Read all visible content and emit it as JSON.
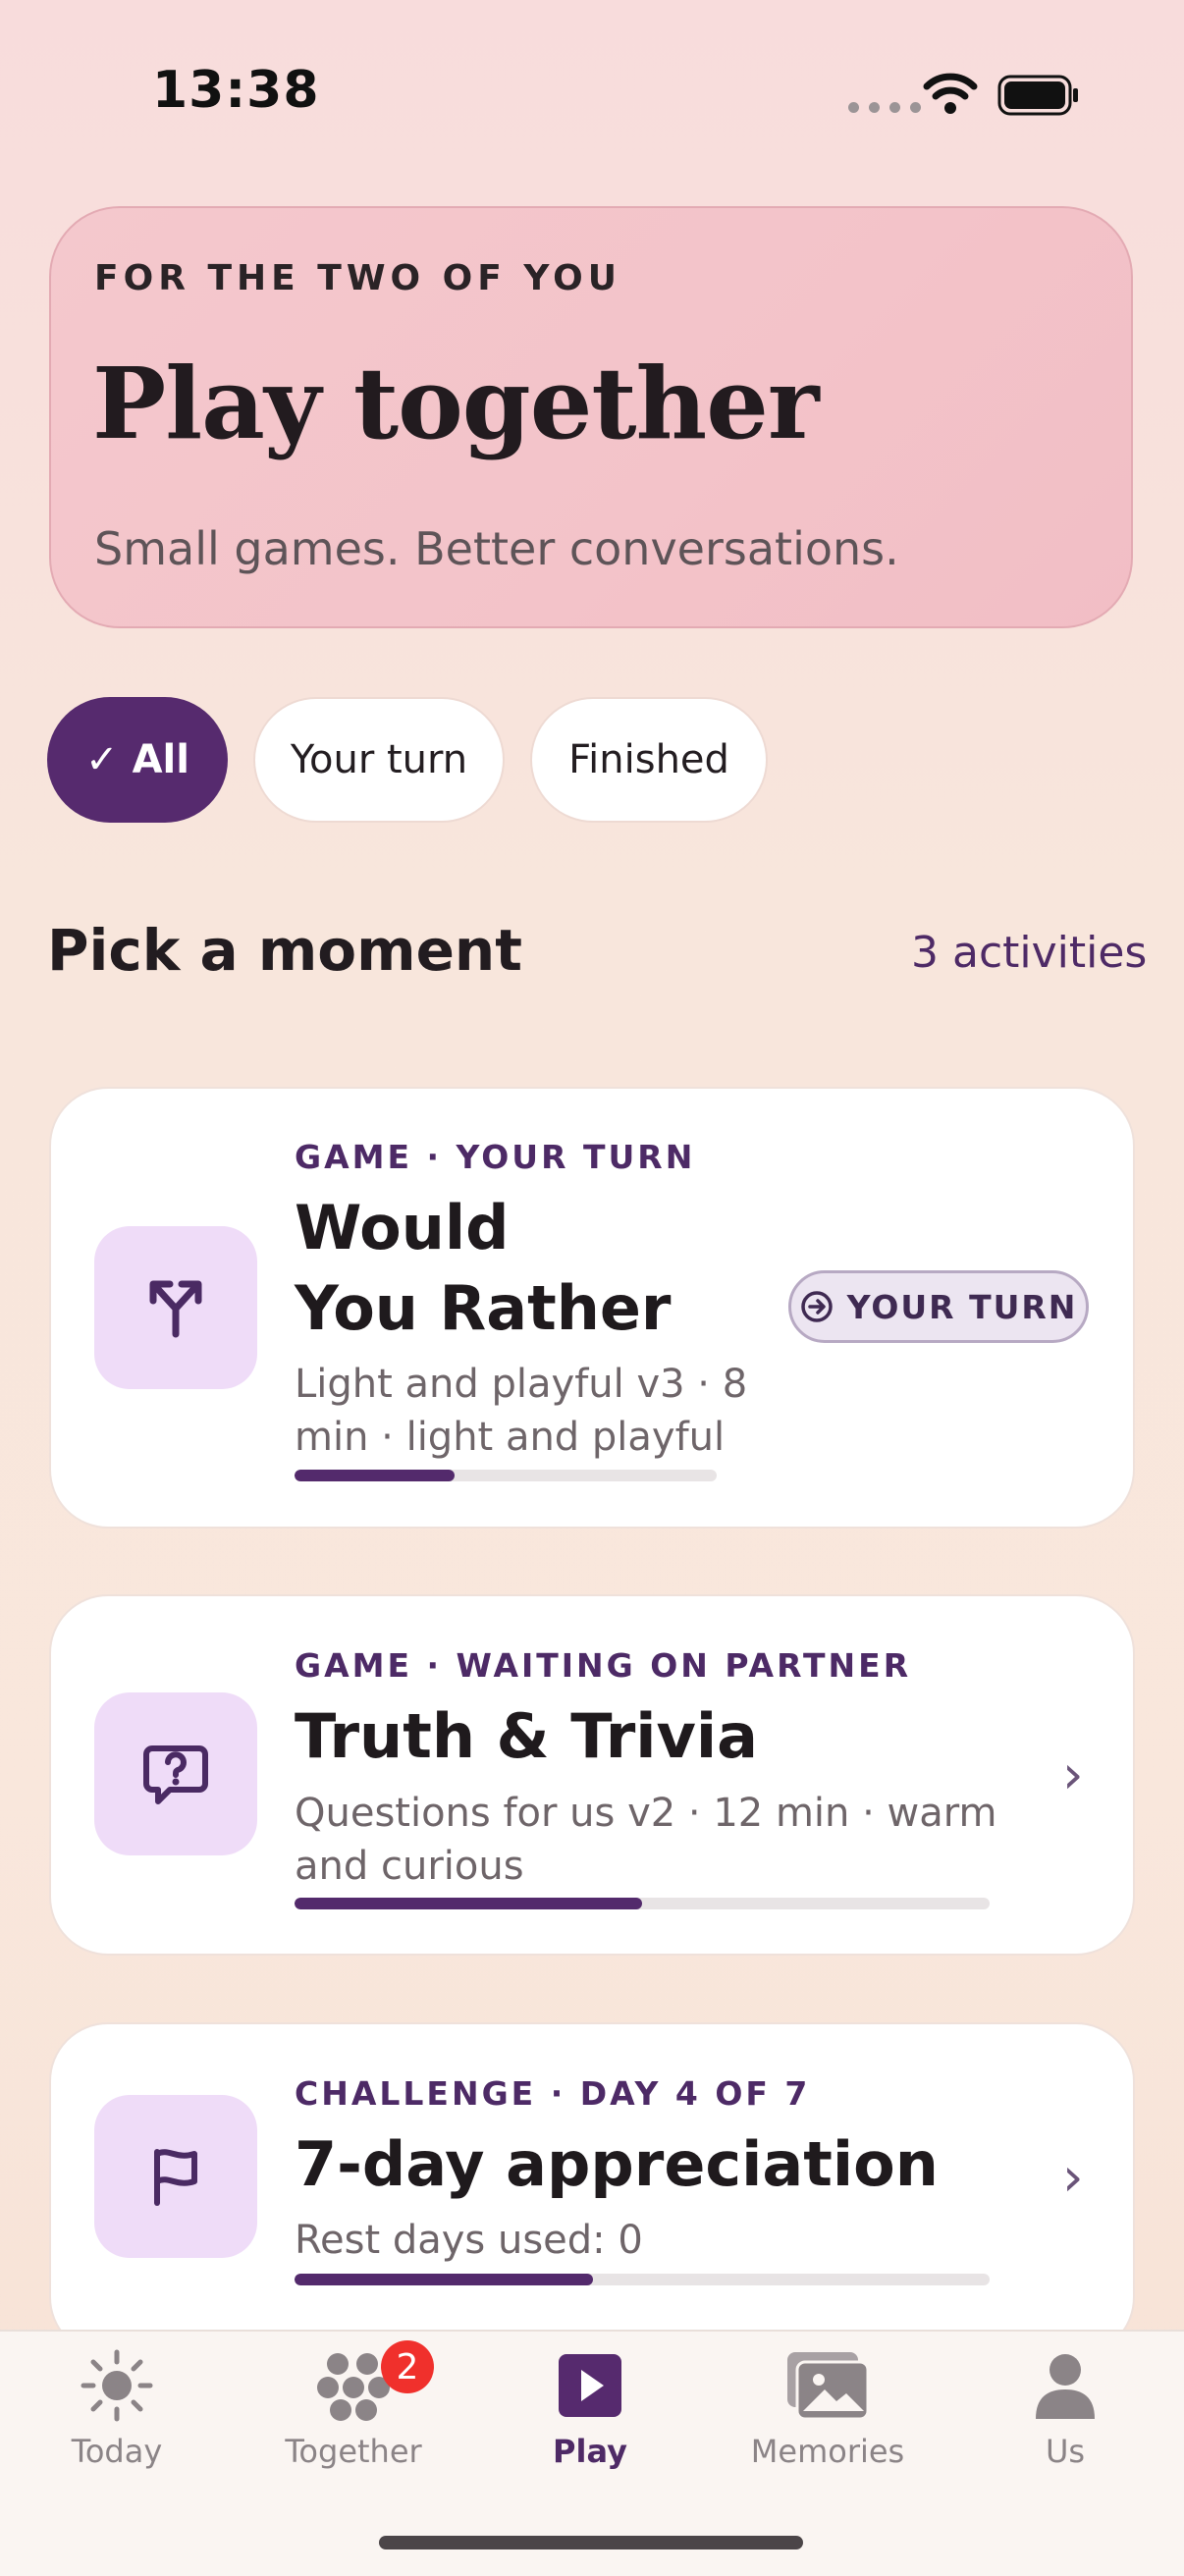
{
  "status_bar": {
    "time": "13:38"
  },
  "hero": {
    "kicker": "FOR THE TWO OF YOU",
    "title": "Play together",
    "subtitle": "Small games. Better conversations."
  },
  "filters": {
    "all": "All",
    "your_turn": "Your turn",
    "finished": "Finished",
    "selected": "All"
  },
  "section": {
    "title": "Pick a moment",
    "count": "3 activities"
  },
  "cards": [
    {
      "eyebrow": "GAME · YOUR TURN",
      "title_line1": "Would",
      "title_line2": "You Rather",
      "sub_line1": "Light and playful v3 · 8",
      "sub_line2": "min · light and playful",
      "badge": "YOUR TURN",
      "progress": 0.38,
      "icon": "split-arrow-icon"
    },
    {
      "eyebrow": "GAME · WAITING ON PARTNER",
      "title": "Truth & Trivia",
      "sub_line1": "Questions for us v2 · 12 min · warm",
      "sub_line2": "and curious",
      "progress": 0.5,
      "icon": "question-bubble-icon"
    },
    {
      "eyebrow": "CHALLENGE · DAY 4 OF 7",
      "title": "7-day appreciation",
      "sub_line1": "Rest days used: 0",
      "progress": 0.43,
      "icon": "flag-icon"
    }
  ],
  "tabs": [
    {
      "label": "Today",
      "icon": "sun-icon"
    },
    {
      "label": "Together",
      "icon": "people-cluster-icon",
      "badge": "2"
    },
    {
      "label": "Play",
      "icon": "play-icon",
      "active": true
    },
    {
      "label": "Memories",
      "icon": "photos-icon"
    },
    {
      "label": "Us",
      "icon": "person-icon"
    }
  ],
  "colors": {
    "accent": "#562a6e",
    "icon_tile": "#efdcf8",
    "badge": "#f0302c"
  }
}
